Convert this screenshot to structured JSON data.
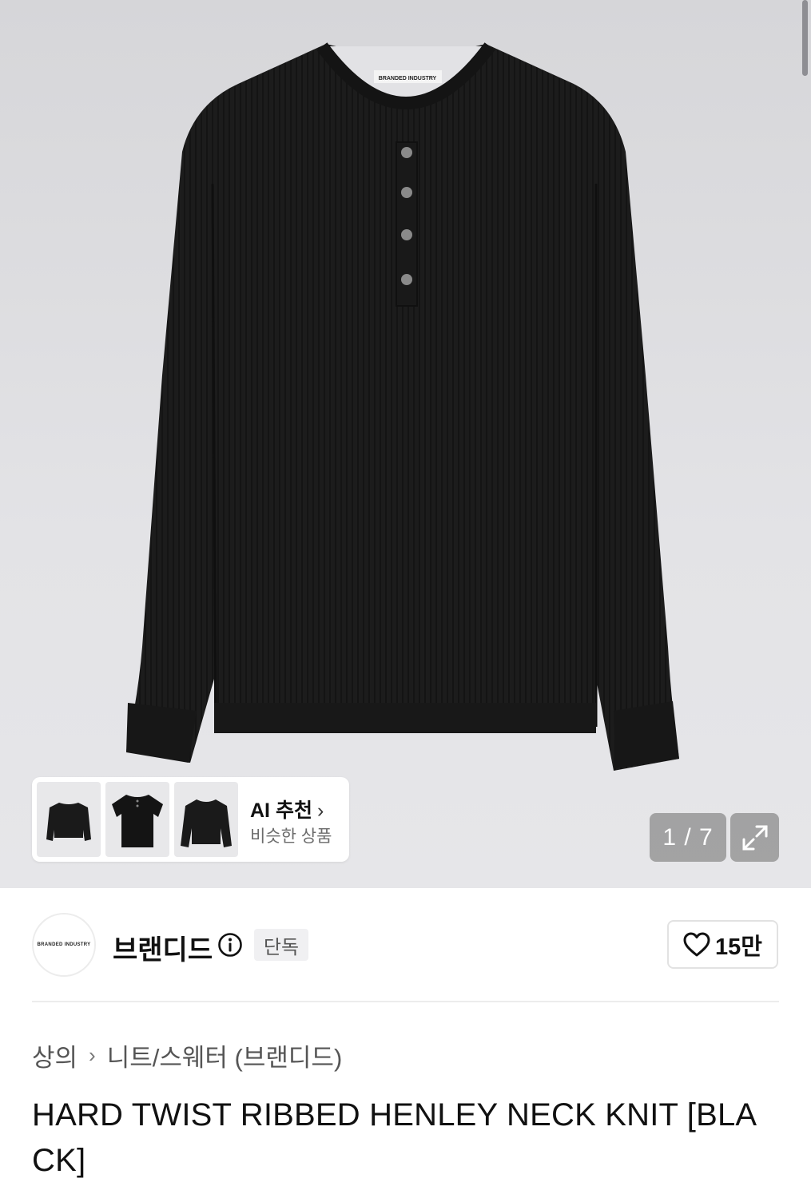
{
  "product": {
    "image_alt": "HARD TWIST RIBBED HENLEY NECK KNIT black sweater",
    "label_text": "BRANDED INDUSTRY",
    "image_counter": "1 / 7"
  },
  "ai_recommend": {
    "title": "AI 추천",
    "chevron": "›",
    "subtitle": "비슷한 상품"
  },
  "brand": {
    "logo_text": "BRANDED INDUSTRY",
    "name": "브랜디드",
    "badge": "단독"
  },
  "like": {
    "count": "15만"
  },
  "breadcrumb": {
    "category": "상의",
    "separator": "›",
    "subcategory": "니트/스웨터 (브랜디드)"
  },
  "title": "HARD TWIST RIBBED HENLEY NECK KNIT [BLACK]",
  "colors": {
    "hero_bg": "#dcdcdf",
    "sweater": "#1c1c1c",
    "overlay_btn": "#969696"
  }
}
